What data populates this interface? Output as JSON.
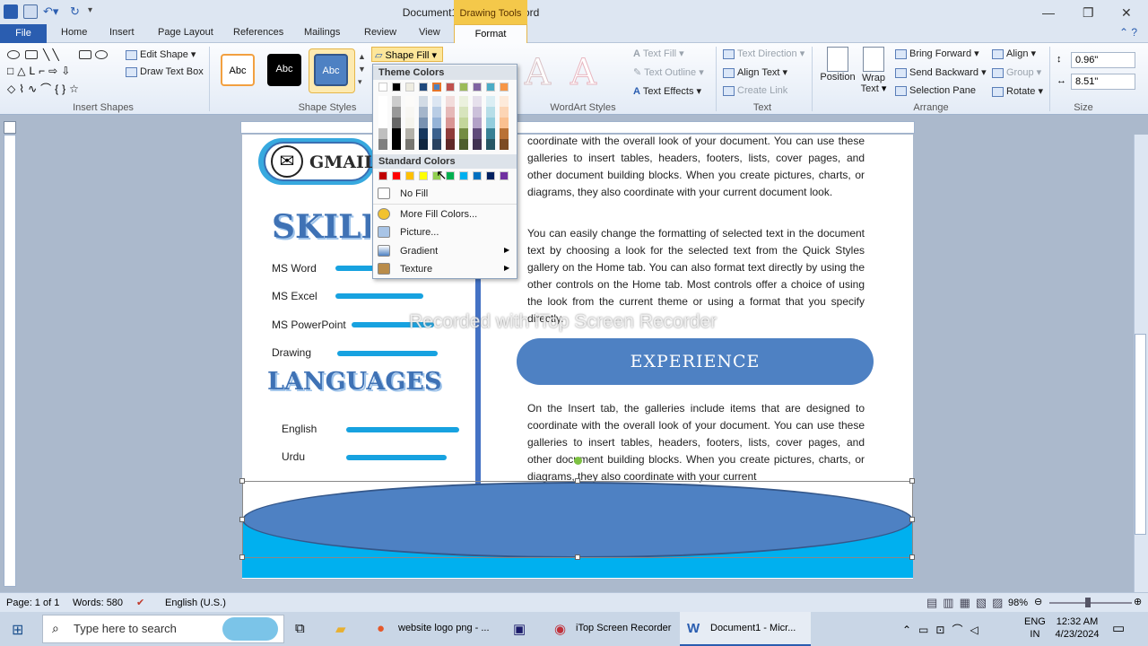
{
  "titlebar": {
    "title": "Document1 - Microsoft Word",
    "context_tab": "Drawing Tools"
  },
  "tabs": [
    "File",
    "Home",
    "Insert",
    "Page Layout",
    "References",
    "Mailings",
    "Review",
    "View",
    "Format"
  ],
  "ribbon": {
    "groups": {
      "insert_shapes": "Insert Shapes",
      "shape_styles": "Shape Styles",
      "wordart_styles": "WordArt Styles",
      "text": "Text",
      "arrange": "Arrange",
      "size": "Size"
    },
    "edit_shape": "Edit Shape",
    "draw_text_box": "Draw Text Box",
    "style_label": "Abc",
    "shape_fill": "Shape Fill",
    "text_fill": "Text Fill",
    "text_outline": "Text Outline",
    "text_effects": "Text Effects",
    "text_direction": "Text Direction",
    "align_text": "Align Text",
    "create_link": "Create Link",
    "position": "Position",
    "wrap_text_1": "Wrap",
    "wrap_text_2": "Text",
    "bring_forward": "Bring Forward",
    "send_backward": "Send Backward",
    "selection_pane": "Selection Pane",
    "align": "Align",
    "group": "Group",
    "rotate": "Rotate",
    "height": "0.96\"",
    "width": "8.51\""
  },
  "dropdown": {
    "theme_colors": "Theme Colors",
    "standard_colors": "Standard Colors",
    "no_fill": "No Fill",
    "more_fill": "More Fill Colors...",
    "picture": "Picture...",
    "gradient": "Gradient",
    "texture": "Texture",
    "theme_top": [
      "#ffffff",
      "#000000",
      "#eeece1",
      "#1f497d",
      "#4f81bd",
      "#c0504d",
      "#9bbb59",
      "#8064a2",
      "#4bacc6",
      "#f79646"
    ],
    "standard": [
      "#c00000",
      "#ff0000",
      "#ffc000",
      "#ffff00",
      "#92d050",
      "#00b050",
      "#00b0f0",
      "#0070c0",
      "#002060",
      "#7030a0"
    ]
  },
  "document": {
    "gmail": "GMAIL",
    "skills_title": "SKILLS",
    "languages_title": "LANGUAGES",
    "skills": [
      {
        "name": "MS Word",
        "level": 0.6
      },
      {
        "name": "MS Excel",
        "level": 0.7
      },
      {
        "name": "MS PowerPoint",
        "level": 0.66
      },
      {
        "name": "Drawing",
        "level": 0.8
      }
    ],
    "languages": [
      {
        "name": "English",
        "level": 0.9
      },
      {
        "name": "Urdu",
        "level": 0.8
      }
    ],
    "para1": "coordinate with the overall look of your document. You can use these galleries to insert tables, headers, footers, lists, cover pages, and other document building blocks. When you create pictures, charts, or diagrams, they also coordinate with your current document look.",
    "para2": "You can easily change the formatting of selected text in the document text by choosing a look for the selected text from the Quick Styles gallery on the Home tab. You can also format text directly by using the other controls on the Home tab. Most controls offer a choice of using the look from the current theme or using a format that you specify directly.",
    "experience": "EXPERIENCE",
    "para3": "On the Insert tab, the galleries include items that are designed to coordinate with the overall look of your document. You can use these galleries to insert tables, headers, footers, lists, cover pages, and other document building blocks. When you create pictures, charts, or diagrams, they also coordinate with your current",
    "watermark": "Recorded with iTop Screen Recorder"
  },
  "status": {
    "page": "Page: 1 of 1",
    "words": "Words: 580",
    "language": "English (U.S.)",
    "zoom": "98%"
  },
  "taskbar": {
    "search_placeholder": "Type here to search",
    "firefox": "website logo png - ...",
    "recorder": "iTop Screen Recorder",
    "word": "Document1 - Micr...",
    "lang1": "ENG",
    "lang2": "IN",
    "time": "12:32 AM",
    "date": "4/23/2024"
  }
}
